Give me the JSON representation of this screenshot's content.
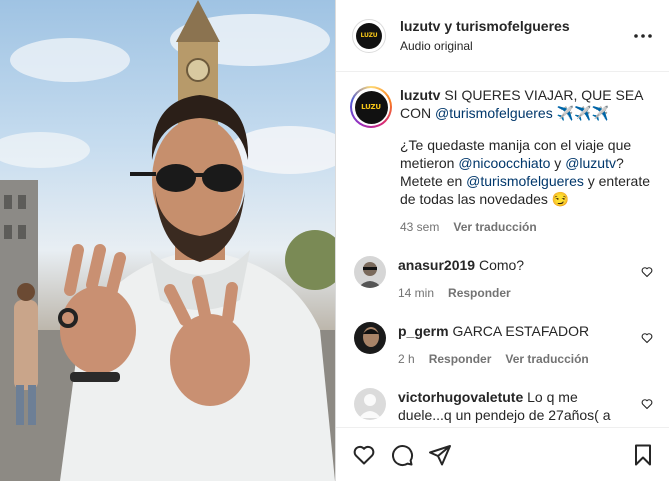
{
  "header": {
    "author": "luzutv",
    "connector": "y",
    "collaborator": "turismofelgueres",
    "audio_label": "Audio original",
    "avatar_logo_text": "LUZU"
  },
  "caption": {
    "username": "luzutv",
    "line1": "SI QUERES VIAJAR, QUE SEA CON",
    "mention1": "@turismofelgueres",
    "emojis1": "✈️✈️✈️",
    "p2_a": "¿Te quedaste manija con el viaje que metieron",
    "mention2": "@nicoocchiato",
    "p2_b": "y",
    "mention3": "@luzutv",
    "p2_c": "? Metete en",
    "mention4": "@turismofelgueres",
    "p2_d": "y enterate de todas las novedades",
    "emoji2": "😏",
    "time": "43 sem",
    "see_translation": "Ver traducción"
  },
  "comments": [
    {
      "username": "anasur2019",
      "text": "Como?",
      "time": "14 min",
      "actions": [
        "Responder"
      ]
    },
    {
      "username": "p_germ",
      "text": "GARCA ESTAFADOR",
      "time": "2 h",
      "actions": [
        "Responder",
        "Ver traducción"
      ]
    },
    {
      "username": "victorhugovaletute",
      "text": "Lo q me duele...q un pendejo de 27años( a"
    }
  ],
  "icons": {
    "more": "more-options-icon",
    "like": "heart-icon",
    "comment": "comment-icon",
    "share": "share-icon",
    "save": "bookmark-icon"
  }
}
